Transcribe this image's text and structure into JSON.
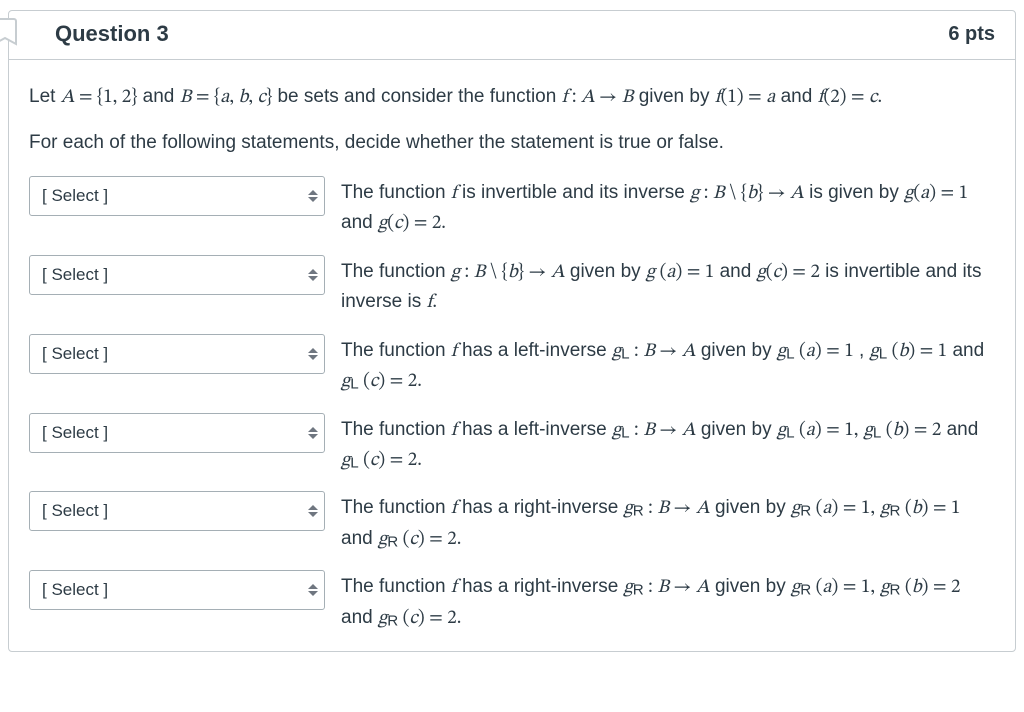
{
  "header": {
    "title": "Question 3",
    "points": "6 pts"
  },
  "prompt": {
    "t1": "Let ",
    "t2": " and ",
    "t3": " be sets and consider the function ",
    "t4": " given by ",
    "t5": " and "
  },
  "math": {
    "A_def": "A = {1, 2}",
    "B_def": "B = {a, b, c}",
    "f_sig": "f : A → B",
    "f1": "f(1) = a",
    "f2": "f(2) = c.",
    "g_sig": "g : B \\ {b} → A",
    "ga1": "g(a) = 1",
    "gc2": "g(c) = 2.",
    "ga1b": "g (a)  =  1",
    "gc2b": "g(c) = 2",
    "gL_sig": "gL : B → A",
    "gLa1": "gL (a) = 1",
    "gLb1": "gL (b) = 1",
    "gLc2": "gL (c) = 2.",
    "gLa1b": "gL (a) = 1,",
    "gLb2": "gL (b) = 2",
    "gLc2b": "gL (c) = 2.",
    "gR_sig": "gR : B → A",
    "gRa1": "gR (a) = 1,",
    "gRb1": "gR (b) = 1",
    "gRc2": "gR (c) = 2.",
    "gRb2": "gR (b) = 2"
  },
  "instruction": "For each of the following statements, decide whether the statement is true  or false.",
  "select_placeholder": "[ Select ]",
  "statements": {
    "s1": {
      "p1": "The function ",
      "p2": " is invertible and its inverse ",
      "p3": " is given by ",
      "p4": " and "
    },
    "s2": {
      "p1": "The function ",
      "p2": " given by ",
      "p3": " and ",
      "p4": " is invertible and its inverse is "
    },
    "s3": {
      "p1": "The function ",
      "p2": " has a left-inverse ",
      "p3": " given by ",
      "p4": " , ",
      "p5": " and "
    },
    "s4": {
      "p1": "The function ",
      "p2": " has a left-inverse ",
      "p3": " given by ",
      "p4": " and "
    },
    "s5": {
      "p1": "The function ",
      "p2": " has a right-inverse ",
      "p3": " given by ",
      "p4": " and "
    },
    "s6": {
      "p1": "The function ",
      "p2": " has a right-inverse ",
      "p3": " given by ",
      "p4": " and "
    }
  },
  "mtext": {
    "f": "f",
    "period": ".",
    "comma": ","
  }
}
